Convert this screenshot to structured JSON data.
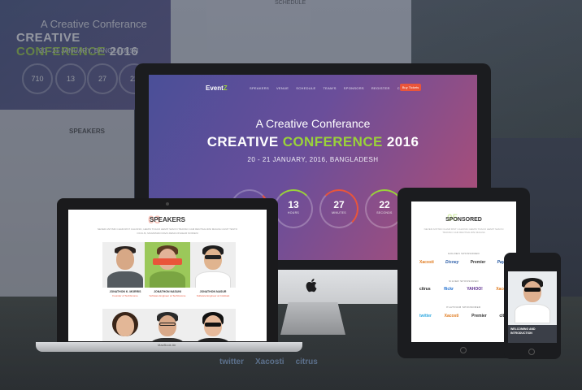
{
  "background": {
    "hero_subtitle": "A Creative Conferance",
    "hero_title_a": "CREATIVE",
    "hero_title_b": "CONFERENCE",
    "hero_title_c": "2016",
    "hero_date": "20 - 21 JANUARY, BANGLADESH",
    "rings": [
      "710",
      "13",
      "27",
      "22"
    ],
    "schedule_title": "SCHEDULE",
    "speakers_title": "SPEAKERS",
    "bottom_logos": [
      "twitter",
      "Xacosti",
      "citrus"
    ]
  },
  "imac": {
    "logo_a": "Event",
    "logo_b": "Z",
    "menu": [
      "SPEAKERS",
      "VENUE",
      "SCHEDULE",
      "TEAM'S",
      "SPONSORS",
      "REGISTER",
      "CONTACT"
    ],
    "buy_button": "Buy Tickets",
    "subtitle": "A Creative Conferance",
    "title_a": "CREATIVE",
    "title_b": "CONFERENCE",
    "title_c": "2016",
    "date": "20 - 21 JANUARY, 2016, BANGLADESH",
    "counters": [
      {
        "value": "",
        "label": ""
      },
      {
        "value": "13",
        "label": "HOURS"
      },
      {
        "value": "27",
        "label": "MINUTES"
      },
      {
        "value": "22",
        "label": "SECONDS"
      }
    ]
  },
  "laptop": {
    "section_ghost": "03",
    "section_title": "SPEAKERS",
    "section_desc": "NEVER ANTISIN CHAM RIST CALKINIC, HEMIS TOACO HEMIT SAM IN TRANSO CAM RENTSALIDNI MAGNA CANIT TESTO OCULIS, MAGNIMAD RAVIA DEMA DIVAEAR NOIDENI",
    "model_label": "MacBook Air",
    "speakers": [
      {
        "name": "JONATHON K. MORRIS",
        "role": "Founder of TechGnome"
      },
      {
        "name": "JONATHON NASUNI",
        "role": "Software Engineer at TechGnome"
      },
      {
        "name": "JONATHON NASUR",
        "role": "Software Engineer at Coldcast"
      },
      {
        "name": "",
        "role": ""
      },
      {
        "name": "",
        "role": ""
      },
      {
        "name": "",
        "role": ""
      }
    ]
  },
  "ipad": {
    "ghost": "05",
    "title": "SPONSORED",
    "desc": "NEVER ANTISIN CHAM RIST CALKINIC HEMIS TOACO HEMIT SAM IN TRANSO CAM RENTSALIDNI MAGNA",
    "tiers": [
      {
        "label": "GOLDEN SPONSORED",
        "logos": [
          "Xacosti",
          "Disney",
          "Premier",
          "PayPal"
        ]
      },
      {
        "label": "SILVER SPONSORED",
        "logos": [
          "citrus",
          "flickr",
          "YAHOO!",
          "Xacosti"
        ]
      },
      {
        "label": "PLATINUM SPONSORED",
        "logos": [
          "twitter",
          "Xacosti",
          "Premier",
          "citrus"
        ]
      }
    ]
  },
  "phone": {
    "card_text": "WELCOMING AND INTRODUCTION"
  },
  "colors": {
    "accent_green": "#9ad23a",
    "accent_orange": "#e9553a"
  }
}
